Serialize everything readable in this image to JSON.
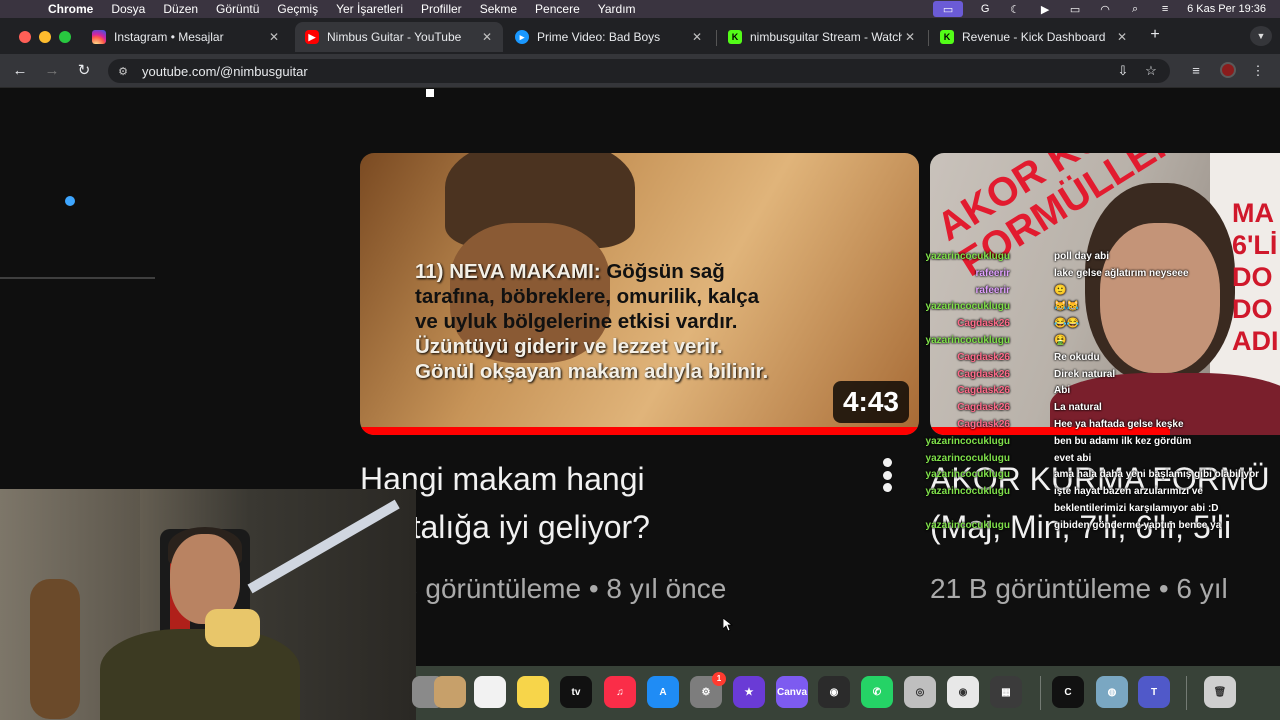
{
  "menubar": {
    "app": "Chrome",
    "items": [
      "Dosya",
      "Düzen",
      "Görüntü",
      "Geçmiş",
      "Yer İşaretleri",
      "Profiller",
      "Sekme",
      "Pencere",
      "Yardım"
    ],
    "clock": "6 Kas Per  19:36"
  },
  "tabs": [
    {
      "title": "Instagram • Mesajlar",
      "icon": "instagram-icon",
      "color": "#d6249f",
      "active": false
    },
    {
      "title": "Nimbus Guitar - YouTube",
      "icon": "youtube-icon",
      "color": "#ff0000",
      "active": true
    },
    {
      "title": "Prime Video: Bad Boys",
      "icon": "prime-video-icon",
      "color": "#1a98ff",
      "active": false
    },
    {
      "title": "nimbusguitar Stream - Watch",
      "icon": "kick-icon",
      "color": "#53fc18",
      "active": false
    },
    {
      "title": "Revenue - Kick Dashboard",
      "icon": "kick-icon",
      "color": "#53fc18",
      "active": false
    }
  ],
  "address": {
    "url": "youtube.com/@nimbusguitar"
  },
  "videos": [
    {
      "title_line1": "Hangi makam hangi",
      "title_line2": "hastalığa iyi geliyor?",
      "duration": "4:43",
      "views": "18 B görüntüleme",
      "age": "8 yıl önce",
      "thumb_text_line1_prefix": "11) NEVA MAKAMI:",
      "thumb_text_line1_rest": " Göğsün sağ",
      "thumb_text_line2": "tarafına, böbreklere, omurilik, kalça",
      "thumb_text_line3": "ve uyluk bölgelerine etkisi vardır.",
      "thumb_text_line4": "Üzüntüyü giderir ve lezzet verir.",
      "thumb_text_line5": "Gönül okşayan makam adıyla bilinir."
    },
    {
      "title_line1": "AKOR KURMA FORMÜ",
      "title_line2": "(Maj, Min, 7'li, 6'lı, 5'li",
      "views": "21 B görüntüleme",
      "age": "6 yıl",
      "thumb_diag": "AKOR KURMA",
      "thumb_diag2": "FORMÜLLERİ",
      "thumb_side": "MA\n6'Lİ\nDO\nDO\nADI"
    }
  ],
  "chat": [
    {
      "user": "yazarincocuklugu",
      "msg": "poll day abi",
      "color": "#7fe04a"
    },
    {
      "user": "rafeerir",
      "msg": "lake gelse ağlatırım neyseee",
      "color": "#e0a0ff"
    },
    {
      "user": "rafeerir",
      "msg": "🙂",
      "color": "#e0a0ff"
    },
    {
      "user": "yazarincocuklugu",
      "msg": "😹😹",
      "color": "#7fe04a"
    },
    {
      "user": "Cagdask26",
      "msg": "😂😂",
      "color": "#ff6b8a"
    },
    {
      "user": "yazarincocuklugu",
      "msg": "🤮",
      "color": "#7fe04a"
    },
    {
      "user": "Cagdask26",
      "msg": "Re okudu",
      "color": "#ff6b8a"
    },
    {
      "user": "Cagdask26",
      "msg": "Direk natural",
      "color": "#ff6b8a"
    },
    {
      "user": "Cagdask26",
      "msg": "Abi",
      "color": "#ff6b8a"
    },
    {
      "user": "Cagdask26",
      "msg": "La natural",
      "color": "#ff6b8a"
    },
    {
      "user": "Cagdask26",
      "msg": "Hee ya haftada gelse keşke",
      "color": "#ff6b8a"
    },
    {
      "user": "yazarincocuklugu",
      "msg": "ben bu adamı ilk kez gördüm",
      "color": "#7fe04a"
    },
    {
      "user": "yazarincocuklugu",
      "msg": "evet abi",
      "color": "#7fe04a"
    },
    {
      "user": "yazarincocuklugu",
      "msg": "ama hala daha yeni başlamış gibi olabiliyor",
      "color": "#7fe04a"
    },
    {
      "user": "yazarincocuklugu",
      "msg": "işte hayat bazen arzularımızı ve",
      "color": "#7fe04a"
    },
    {
      "user": "",
      "msg": "beklentilerimizi karşılamıyor abi :D",
      "color": "#7fe04a"
    },
    {
      "user": "yazarincocuklugu",
      "msg": "gibiden gönderme yaptım bence ya",
      "color": "#7fe04a"
    }
  ],
  "dock": [
    {
      "name": "launchpad-icon",
      "color": "#8a8a8a",
      "label": ""
    },
    {
      "name": "contacts-icon",
      "color": "#c7a06a",
      "label": ""
    },
    {
      "name": "reminders-icon",
      "color": "#f2f2f2",
      "label": ""
    },
    {
      "name": "notes-icon",
      "color": "#f7d54a",
      "label": ""
    },
    {
      "name": "apple-tv-icon",
      "color": "#111111",
      "label": "tv"
    },
    {
      "name": "music-icon",
      "color": "#fa2d48",
      "label": "♫"
    },
    {
      "name": "app-store-icon",
      "color": "#1f8cf5",
      "label": "A"
    },
    {
      "name": "system-settings-icon",
      "color": "#7d7d7d",
      "label": "⚙"
    },
    {
      "name": "imovie-icon",
      "color": "#6a3bd6",
      "label": "★"
    },
    {
      "name": "canva-icon",
      "color": "#7d5bf0",
      "label": "Canva"
    },
    {
      "name": "obs-icon",
      "color": "#2b2b2b",
      "label": "◉"
    },
    {
      "name": "whatsapp-icon",
      "color": "#25d366",
      "label": "✆"
    },
    {
      "name": "disk-utility-icon",
      "color": "#bfbfbf",
      "label": "◎"
    },
    {
      "name": "chrome-icon",
      "color": "#e8e8e8",
      "label": "◉"
    },
    {
      "name": "calculator-icon",
      "color": "#3b3b3b",
      "label": "▦"
    },
    {
      "name": "capcut-icon",
      "color": "#111111",
      "label": "C"
    },
    {
      "name": "network-icon",
      "color": "#7aa7c2",
      "label": "◍"
    },
    {
      "name": "teams-icon",
      "color": "#5059c9",
      "label": "T"
    },
    {
      "name": "trash-icon",
      "color": "#cfcfcf",
      "label": "🗑"
    }
  ],
  "settings_badge": "1"
}
